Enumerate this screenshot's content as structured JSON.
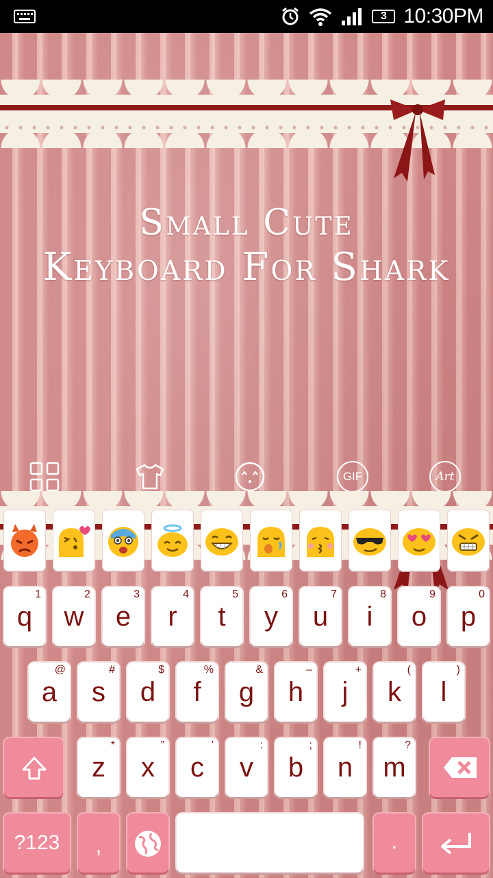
{
  "statusbar": {
    "time": "10:30PM",
    "battery": "3"
  },
  "theme": {
    "title_line1": "Small Cute",
    "title_line2": "Keyboard For Shark"
  },
  "toolbar": {
    "gif_label": "GIF",
    "art_label": "Art"
  },
  "emoji_row": [
    "angry-devil",
    "kiss-heart",
    "scared",
    "angel",
    "grin",
    "sleepy",
    "kiss",
    "sunglasses",
    "heart-eyes",
    "grimace"
  ],
  "keyboard": {
    "row1": [
      {
        "key": "q",
        "sub": "1"
      },
      {
        "key": "w",
        "sub": "2"
      },
      {
        "key": "e",
        "sub": "3"
      },
      {
        "key": "r",
        "sub": "4"
      },
      {
        "key": "t",
        "sub": "5"
      },
      {
        "key": "y",
        "sub": "6"
      },
      {
        "key": "u",
        "sub": "7"
      },
      {
        "key": "i",
        "sub": "8"
      },
      {
        "key": "o",
        "sub": "9"
      },
      {
        "key": "p",
        "sub": "0"
      }
    ],
    "row2": [
      {
        "key": "a",
        "sub": "@"
      },
      {
        "key": "s",
        "sub": "#"
      },
      {
        "key": "d",
        "sub": "$"
      },
      {
        "key": "f",
        "sub": "%"
      },
      {
        "key": "g",
        "sub": "&"
      },
      {
        "key": "h",
        "sub": "–"
      },
      {
        "key": "j",
        "sub": "+"
      },
      {
        "key": "k",
        "sub": "("
      },
      {
        "key": "l",
        "sub": ")"
      }
    ],
    "row3": [
      {
        "key": "z",
        "sub": "*"
      },
      {
        "key": "x",
        "sub": "”"
      },
      {
        "key": "c",
        "sub": "’"
      },
      {
        "key": "v",
        "sub": ":"
      },
      {
        "key": "b",
        "sub": ";"
      },
      {
        "key": "n",
        "sub": "!"
      },
      {
        "key": "m",
        "sub": "?"
      }
    ],
    "symbols_label": "?123",
    "comma_label": ",",
    "period_label": "."
  },
  "colors": {
    "accent_pink": "#f08b9b",
    "key_text": "#7a1212",
    "ribbon": "#8e1a1a"
  }
}
